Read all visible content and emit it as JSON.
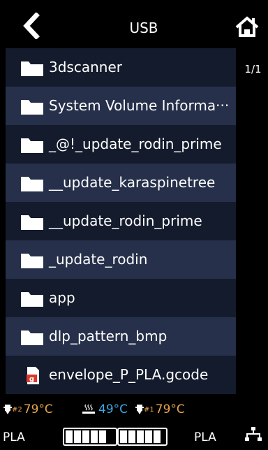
{
  "header": {
    "title": "USB"
  },
  "pager": {
    "text": "1/1"
  },
  "files": [
    {
      "name": "3dscanner",
      "type": "folder"
    },
    {
      "name": "System Volume Informa···",
      "type": "folder"
    },
    {
      "name": "_@!_update_rodin_prime",
      "type": "folder"
    },
    {
      "name": "__update_karaspinetree",
      "type": "folder"
    },
    {
      "name": "__update_rodin_prime",
      "type": "folder"
    },
    {
      "name": "_update_rodin",
      "type": "folder"
    },
    {
      "name": "app",
      "type": "folder"
    },
    {
      "name": "dlp_pattern_bmp",
      "type": "folder"
    },
    {
      "name": "envelope_P_PLA.gcode",
      "type": "gcode"
    }
  ],
  "status": {
    "nozzle2": {
      "sub": "#2",
      "value": "79°C"
    },
    "bed": {
      "value": "49°C"
    },
    "nozzle1": {
      "sub": "#1",
      "value": "79°C"
    }
  },
  "bottom": {
    "material_left": "PLA",
    "material_right": "PLA"
  },
  "colors": {
    "accent_orange": "#e8a64b",
    "accent_blue": "#3ea8e8",
    "row_dark": "#141b2c",
    "row_light": "#26304a"
  }
}
